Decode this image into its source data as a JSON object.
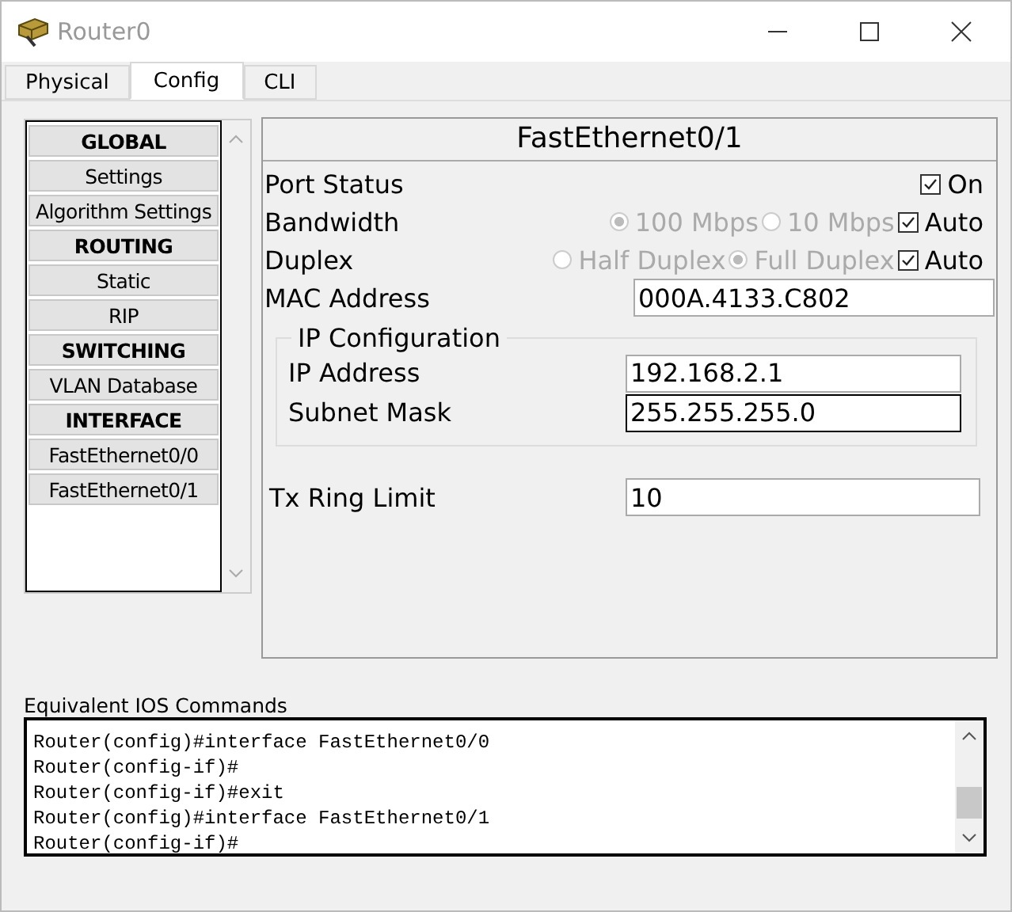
{
  "window": {
    "title": "Router0"
  },
  "tabs": [
    {
      "label": "Physical",
      "selected": false
    },
    {
      "label": "Config",
      "selected": true
    },
    {
      "label": "CLI",
      "selected": false
    }
  ],
  "sidebar": {
    "items": [
      {
        "label": "GLOBAL",
        "kind": "header"
      },
      {
        "label": "Settings",
        "kind": "item"
      },
      {
        "label": "Algorithm Settings",
        "kind": "item"
      },
      {
        "label": "ROUTING",
        "kind": "header"
      },
      {
        "label": "Static",
        "kind": "item"
      },
      {
        "label": "RIP",
        "kind": "item"
      },
      {
        "label": "SWITCHING",
        "kind": "header"
      },
      {
        "label": "VLAN Database",
        "kind": "item"
      },
      {
        "label": "INTERFACE",
        "kind": "header"
      },
      {
        "label": "FastEthernet0/0",
        "kind": "item"
      },
      {
        "label": "FastEthernet0/1",
        "kind": "item"
      }
    ]
  },
  "panel": {
    "title": "FastEthernet0/1",
    "rows": [
      {
        "kind": "checkbox",
        "label": "Port Status",
        "checkbox": {
          "label": "On",
          "checked": true
        }
      },
      {
        "kind": "radio",
        "label": "Bandwidth",
        "disabled": true,
        "options": [
          {
            "label": "100 Mbps",
            "selected": true
          },
          {
            "label": "10 Mbps",
            "selected": false
          }
        ],
        "checkbox": {
          "label": "Auto",
          "checked": true
        }
      },
      {
        "kind": "radio",
        "label": "Duplex",
        "disabled": true,
        "options": [
          {
            "label": "Half Duplex",
            "selected": false
          },
          {
            "label": "Full Duplex",
            "selected": true
          }
        ],
        "checkbox": {
          "label": "Auto",
          "checked": true
        }
      },
      {
        "kind": "field",
        "label": "MAC Address",
        "value": "000A.4133.C802"
      }
    ],
    "ip_configuration": {
      "title": "IP Configuration",
      "fields": [
        {
          "label": "IP Address",
          "value": "192.168.2.1"
        },
        {
          "label": "Subnet Mask",
          "value": "255.255.255.0"
        }
      ]
    },
    "tx_ring_limit": {
      "label": "Tx Ring Limit",
      "value": "10"
    }
  },
  "console": {
    "label": "Equivalent IOS Commands",
    "lines": [
      "Router(config)#interface FastEthernet0/0",
      "Router(config-if)#",
      "Router(config-if)#exit",
      "Router(config)#interface FastEthernet0/1",
      "Router(config-if)#"
    ]
  }
}
